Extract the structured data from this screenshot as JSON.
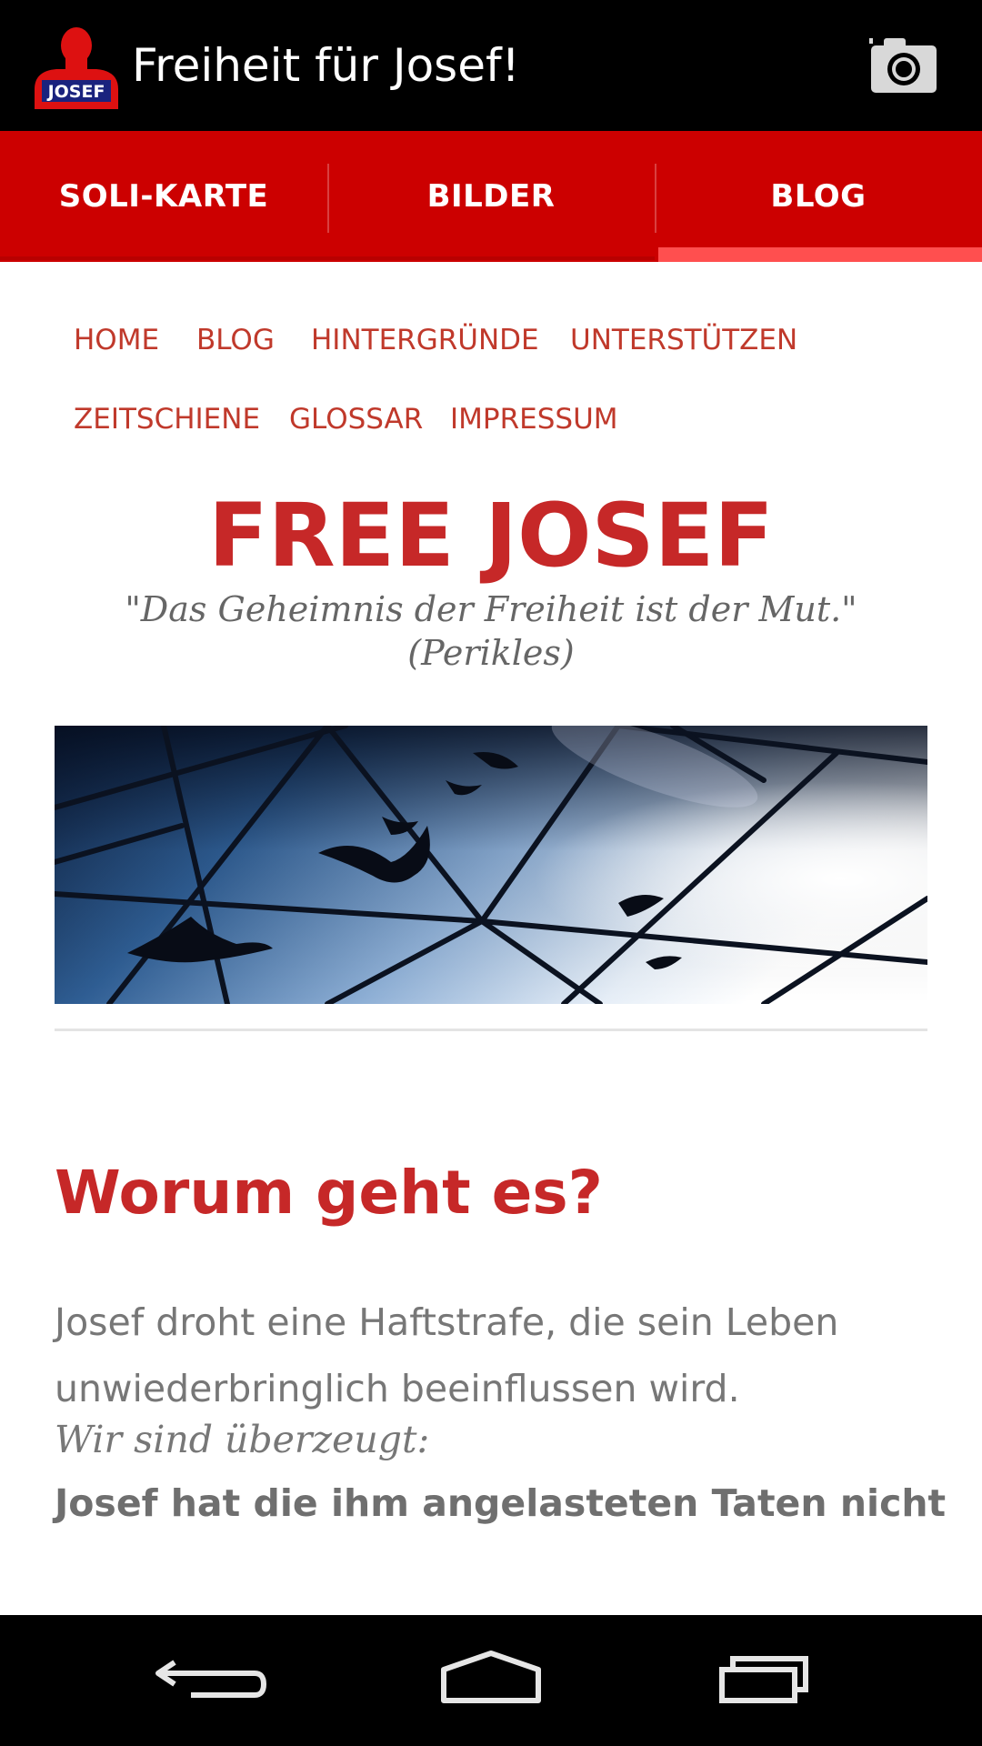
{
  "action_bar": {
    "title": "Freiheit für Josef!",
    "logo_text": "JOSEF",
    "logo_icon": "person-silhouette-icon",
    "action_icon": "camera-icon"
  },
  "tabs": [
    {
      "label": "SOLI-KARTE",
      "selected": false
    },
    {
      "label": "BILDER",
      "selected": false
    },
    {
      "label": "BLOG",
      "selected": true
    }
  ],
  "site": {
    "menu": [
      "HOME",
      "BLOG",
      "HINTERGRÜNDE",
      "UNTERSTÜTZEN",
      "ZEITSCHIENE",
      "GLOSSAR",
      "IMPRESSUM"
    ],
    "title": "FREE JOSEF",
    "tagline_line1": "\"Das Geheimnis der Freiheit ist der Mut.\"",
    "tagline_line2": "(Perikles)"
  },
  "article": {
    "heading": "Worum geht es?",
    "paragraph": "Josef droht eine Haftstrafe, die sein Leben unwiederbringlich beeinflussen wird.",
    "italic_line": "Wir sind überzeugt:",
    "bold_line": "Josef hat die ihm angelasteten Taten nicht"
  },
  "navigation_bar": {
    "icons": [
      "back-icon",
      "home-icon",
      "recent-apps-icon"
    ]
  },
  "colors": {
    "tab_bar": "#cc0000",
    "tab_indicator": "#ff4f4f",
    "site_red": "#c62828",
    "text_gray": "#777777"
  }
}
